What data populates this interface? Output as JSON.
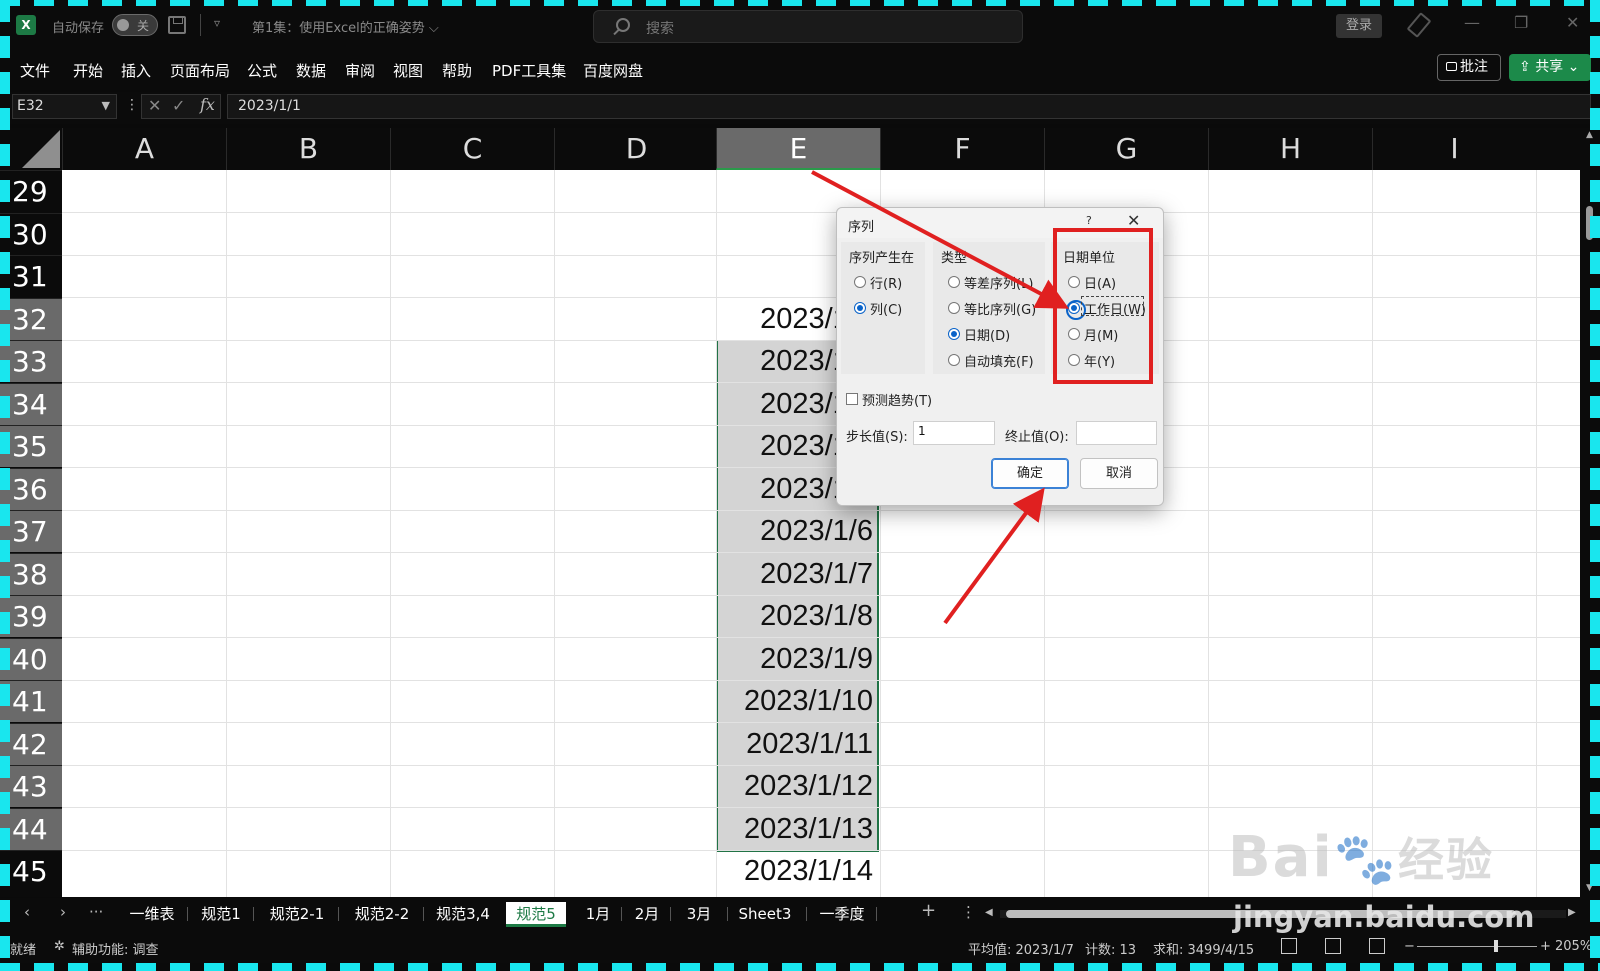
{
  "app": {
    "autosave_label": "自动保存",
    "autosave_state": "关",
    "qat_more": "▿",
    "document_title": "第1集：使用Excel的正确姿势 ⌵",
    "search_placeholder": "搜索",
    "login_label": "登录",
    "logo_letter": "X"
  },
  "menu": [
    "文件",
    "开始",
    "插入",
    "页面布局",
    "公式",
    "数据",
    "审阅",
    "视图",
    "帮助",
    "PDF工具集",
    "百度网盘"
  ],
  "ribbon_right": {
    "comment_label": "批注",
    "share_label": "共享"
  },
  "formula_bar": {
    "name_box": "E32",
    "formula": "2023/1/1"
  },
  "columns": [
    "A",
    "B",
    "C",
    "D",
    "E",
    "F",
    "G",
    "H",
    "I"
  ],
  "selected_column": "E",
  "rows": [
    "29",
    "30",
    "31",
    "32",
    "33",
    "34",
    "35",
    "36",
    "37",
    "38",
    "39",
    "40",
    "41",
    "42",
    "43",
    "44",
    "45"
  ],
  "column_e_values": [
    "2023/1/1",
    "2023/1/2",
    "2023/1/3",
    "2023/1/4",
    "2023/1/5",
    "2023/1/6",
    "2023/1/7",
    "2023/1/8",
    "2023/1/9",
    "2023/1/10",
    "2023/1/11",
    "2023/1/12",
    "2023/1/13",
    "2023/1/14"
  ],
  "dialog": {
    "title": "序列",
    "help": "?",
    "close": "✕",
    "series_in": {
      "label": "序列产生在",
      "options": [
        "行(R)",
        "列(C)"
      ],
      "selected": "列(C)"
    },
    "type": {
      "label": "类型",
      "options": [
        "等差序列(L)",
        "等比序列(G)",
        "日期(D)",
        "自动填充(F)"
      ],
      "selected": "日期(D)"
    },
    "date_unit": {
      "label": "日期单位",
      "options": [
        "日(A)",
        "工作日(W)",
        "月(M)",
        "年(Y)"
      ],
      "selected": "工作日(W)"
    },
    "trend_label": "预测趋势(T)",
    "step_label": "步长值(S):",
    "step_value": "1",
    "stop_label": "终止值(O):",
    "stop_value": "",
    "ok_label": "确定",
    "cancel_label": "取消"
  },
  "sheet_tabs": {
    "tabs": [
      "一维表",
      "规范1",
      "规范2-1",
      "规范2-2",
      "规范3,4",
      "规范5",
      "1月",
      "2月",
      "3月",
      "Sheet3",
      "一季度"
    ],
    "active": "规范5",
    "more": "···",
    "add": "+",
    "menu": "⋮"
  },
  "status": {
    "ready": "就绪",
    "accessibility": "辅助功能: 调查",
    "average": "平均值: 2023/1/7",
    "count": "计数: 13",
    "sum": "求和: 3499/4/15",
    "zoom": "205%"
  },
  "watermark": {
    "brand": "Bai",
    "brand_cn": "经验",
    "url": "jingyan.baidu.com"
  },
  "colors": {
    "excel_green": "#1d7a45",
    "annotation_red": "#e02020",
    "dialog_blue": "#0a63c9",
    "frame_cyan": "#19e6ee"
  }
}
